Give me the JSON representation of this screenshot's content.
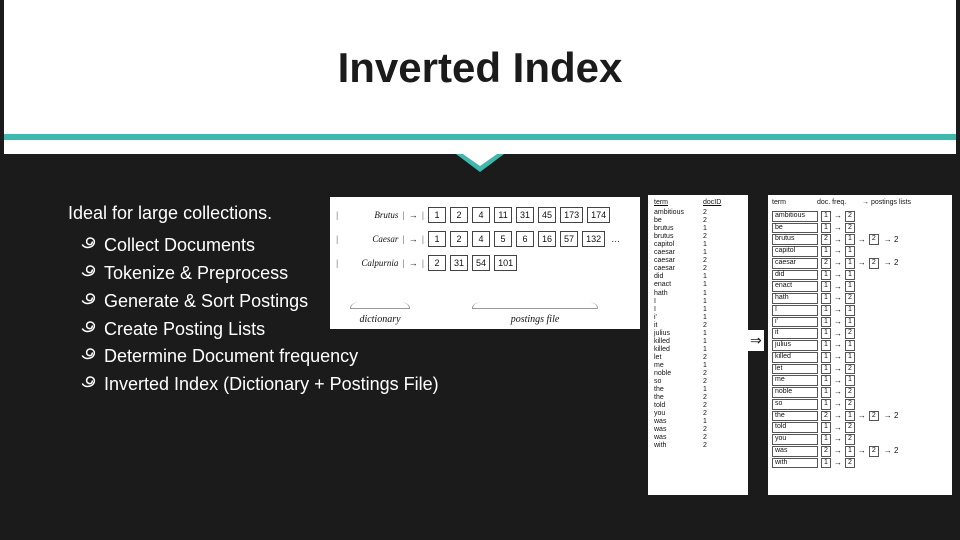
{
  "title": "Inverted Index",
  "intro": "Ideal for large collections.",
  "bullets": [
    "Collect Documents",
    "Tokenize & Preprocess",
    "Generate & Sort Postings",
    "Create Posting Lists",
    "Determine Document frequency",
    "Inverted Index (Dictionary + Postings File)"
  ],
  "fig1": {
    "rows": [
      {
        "term": "Brutus",
        "postings": [
          "1",
          "2",
          "4",
          "11",
          "31",
          "45",
          "173",
          "174"
        ]
      },
      {
        "term": "Caesar",
        "postings": [
          "1",
          "2",
          "4",
          "5",
          "6",
          "16",
          "57",
          "132",
          "..."
        ]
      },
      {
        "term": "Calpurnia",
        "postings": [
          "2",
          "31",
          "54",
          "101"
        ]
      }
    ],
    "label_left": "dictionary",
    "label_right": "postings file"
  },
  "fig2": {
    "left_header": "term",
    "right_header": "docID",
    "rows": [
      [
        "ambitious",
        "2"
      ],
      [
        "be",
        "2"
      ],
      [
        "brutus",
        "1"
      ],
      [
        "brutus",
        "2"
      ],
      [
        "capitol",
        "1"
      ],
      [
        "caesar",
        "1"
      ],
      [
        "caesar",
        "2"
      ],
      [
        "caesar",
        "2"
      ],
      [
        "did",
        "1"
      ],
      [
        "enact",
        "1"
      ],
      [
        "hath",
        "1"
      ],
      [
        "I",
        "1"
      ],
      [
        "I",
        "1"
      ],
      [
        "i'",
        "1"
      ],
      [
        "it",
        "2"
      ],
      [
        "julius",
        "1"
      ],
      [
        "killed",
        "1"
      ],
      [
        "killed",
        "1"
      ],
      [
        "let",
        "2"
      ],
      [
        "me",
        "1"
      ],
      [
        "noble",
        "2"
      ],
      [
        "so",
        "2"
      ],
      [
        "the",
        "1"
      ],
      [
        "the",
        "2"
      ],
      [
        "told",
        "2"
      ],
      [
        "you",
        "2"
      ],
      [
        "was",
        "1"
      ],
      [
        "was",
        "2"
      ],
      [
        "was",
        "2"
      ],
      [
        "with",
        "2"
      ]
    ]
  },
  "fig3": {
    "headers": [
      "term",
      "doc. freq.",
      "→ postings lists"
    ],
    "rows": [
      {
        "term": "ambitious",
        "freq": "1",
        "postings": [
          "2"
        ]
      },
      {
        "term": "be",
        "freq": "1",
        "postings": [
          "2"
        ]
      },
      {
        "term": "brutus",
        "freq": "2",
        "postings": [
          "1",
          "2"
        ],
        "ext": "→ 2"
      },
      {
        "term": "capitol",
        "freq": "1",
        "postings": [
          "1"
        ]
      },
      {
        "term": "caesar",
        "freq": "2",
        "postings": [
          "1",
          "2"
        ],
        "ext": "→ 2"
      },
      {
        "term": "did",
        "freq": "1",
        "postings": [
          "1"
        ]
      },
      {
        "term": "enact",
        "freq": "1",
        "postings": [
          "1"
        ]
      },
      {
        "term": "hath",
        "freq": "1",
        "postings": [
          "2"
        ]
      },
      {
        "term": "I",
        "freq": "1",
        "postings": [
          "1"
        ]
      },
      {
        "term": "i'",
        "freq": "1",
        "postings": [
          "1"
        ]
      },
      {
        "term": "it",
        "freq": "1",
        "postings": [
          "2"
        ]
      },
      {
        "term": "julius",
        "freq": "1",
        "postings": [
          "1"
        ]
      },
      {
        "term": "killed",
        "freq": "1",
        "postings": [
          "1"
        ]
      },
      {
        "term": "let",
        "freq": "1",
        "postings": [
          "2"
        ]
      },
      {
        "term": "me",
        "freq": "1",
        "postings": [
          "1"
        ]
      },
      {
        "term": "noble",
        "freq": "1",
        "postings": [
          "2"
        ]
      },
      {
        "term": "so",
        "freq": "1",
        "postings": [
          "2"
        ]
      },
      {
        "term": "the",
        "freq": "2",
        "postings": [
          "1",
          "2"
        ],
        "ext": "→ 2"
      },
      {
        "term": "told",
        "freq": "1",
        "postings": [
          "2"
        ]
      },
      {
        "term": "you",
        "freq": "1",
        "postings": [
          "2"
        ]
      },
      {
        "term": "was",
        "freq": "2",
        "postings": [
          "1",
          "2"
        ],
        "ext": "→ 2"
      },
      {
        "term": "with",
        "freq": "1",
        "postings": [
          "2"
        ]
      }
    ]
  },
  "arrow_big": "⇒"
}
